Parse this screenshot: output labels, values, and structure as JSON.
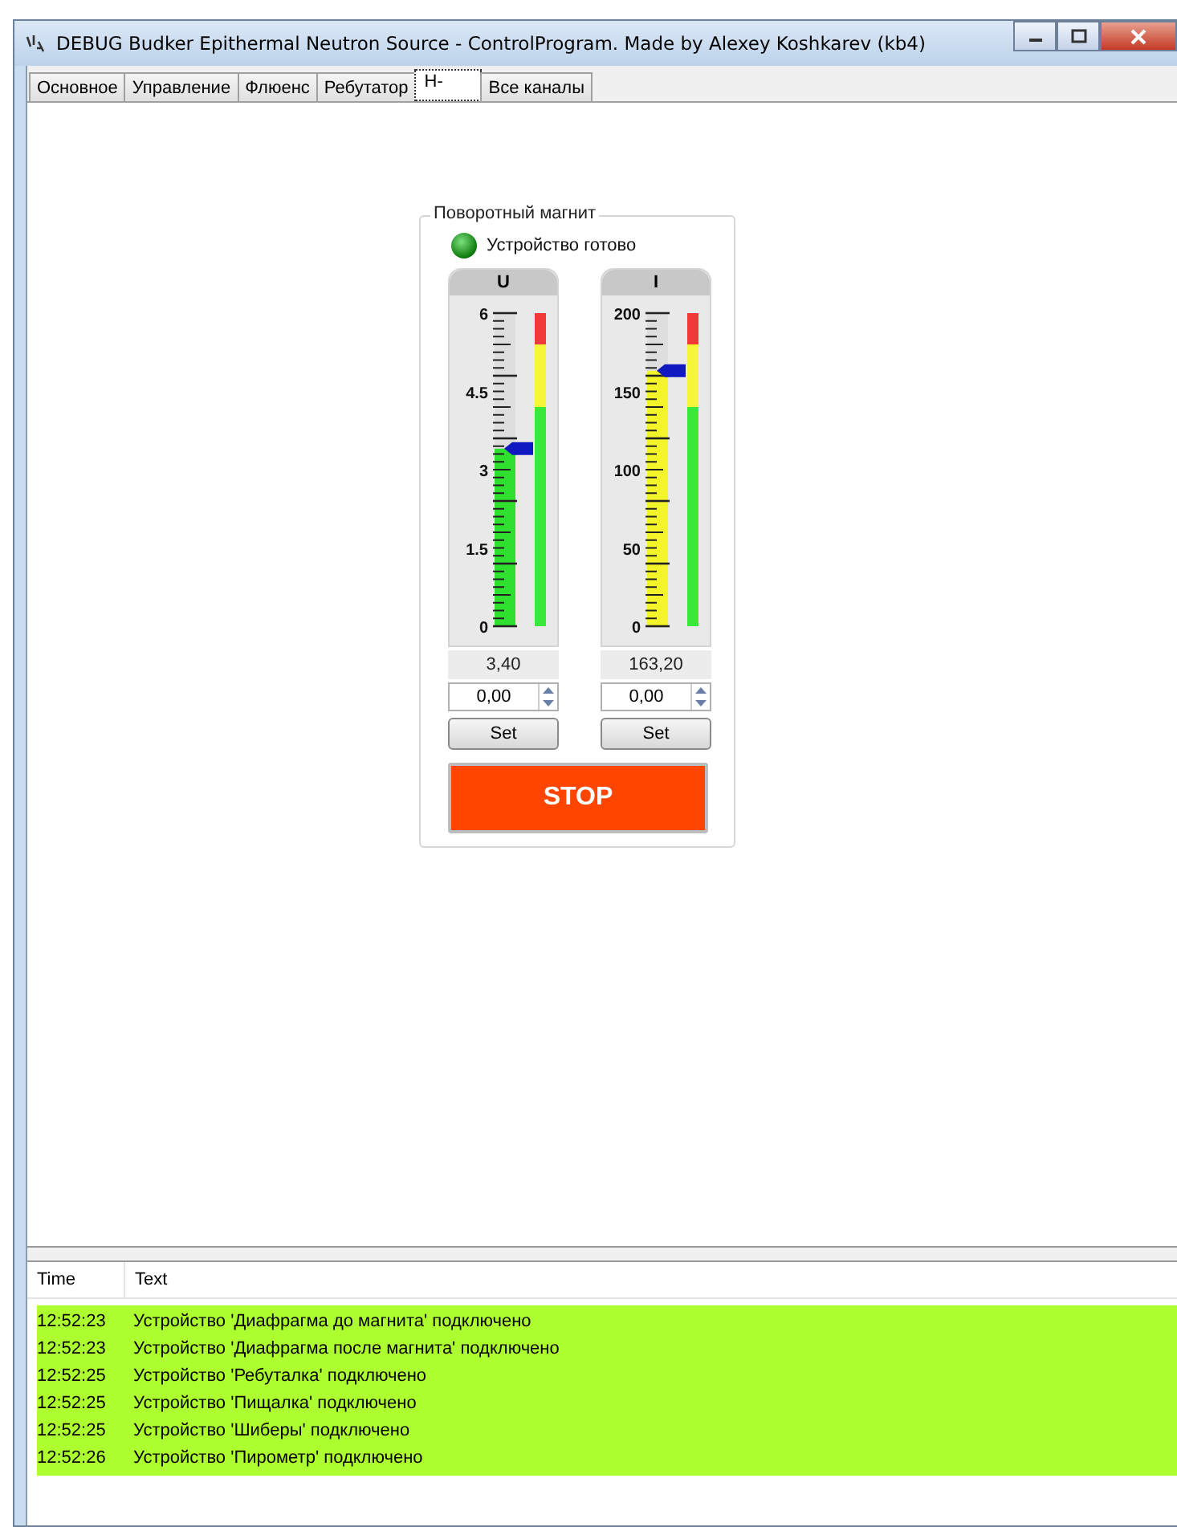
{
  "window": {
    "title": "DEBUG Budker Epithermal Neutron Source - ControlProgram. Made by Alexey Koshkarev (kb4)"
  },
  "tabs": [
    {
      "label": "Основное",
      "selected": false
    },
    {
      "label": "Управление",
      "selected": false
    },
    {
      "label": "Флюенс",
      "selected": false
    },
    {
      "label": "Ребутатор",
      "selected": false
    },
    {
      "label": "H-",
      "selected": true
    },
    {
      "label": "Все каналы",
      "selected": false
    }
  ],
  "group": {
    "title": "Поворотный магнит",
    "status": {
      "text": "Устройство готово",
      "ready": true
    },
    "gauges": [
      {
        "label": "U",
        "ticks": [
          "6",
          "4.5",
          "3",
          "1.5",
          "0"
        ],
        "level": 0.567,
        "reading": "3,40",
        "setpoint": "0,00",
        "button": "Set"
      },
      {
        "label": "I",
        "ticks": [
          "200",
          "150",
          "100",
          "50",
          "0"
        ],
        "level": 0.816,
        "reading": "163,20",
        "setpoint": "0,00",
        "button": "Set"
      }
    ],
    "stop_button": "STOP"
  },
  "log": {
    "columns": [
      "Time",
      "Text"
    ],
    "rows": [
      {
        "time": "12:52:23",
        "text": "Устройство 'Диафрагма до магнита' подключено"
      },
      {
        "time": "12:52:23",
        "text": "Устройство 'Диафрагма после магнита' подключено"
      },
      {
        "time": "12:52:25",
        "text": "Устройство 'Ребуталка' подключено"
      },
      {
        "time": "12:52:25",
        "text": "Устройство 'Пищалка' подключено"
      },
      {
        "time": "12:52:25",
        "text": "Устройство 'Шиберы' подключено"
      },
      {
        "time": "12:52:26",
        "text": "Устройство 'Пирометр' подключено"
      }
    ]
  }
}
